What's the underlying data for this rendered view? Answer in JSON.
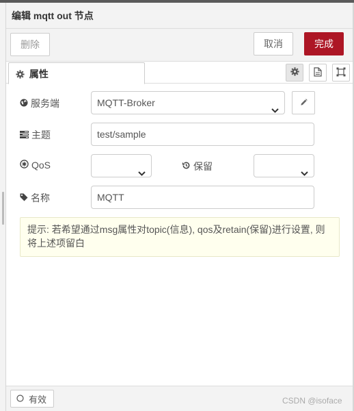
{
  "window": {
    "title": "编辑 mqtt out 节点"
  },
  "toolbar": {
    "delete_label": "删除",
    "cancel_label": "取消",
    "done_label": "完成"
  },
  "tabs": [
    {
      "label": "属性",
      "icon": "gear-icon",
      "active": true
    }
  ],
  "tab_icons": [
    "gear-icon",
    "document-icon",
    "frame-icon"
  ],
  "form": {
    "server": {
      "label": "服务端",
      "icon": "globe-icon",
      "value": "MQTT-Broker"
    },
    "topic": {
      "label": "主题",
      "icon": "tasks-icon",
      "value": "test/sample"
    },
    "qos": {
      "label": "QoS",
      "icon": "asterisk-circle-icon",
      "value": ""
    },
    "retain": {
      "label": "保留",
      "icon": "history-icon",
      "value": ""
    },
    "name": {
      "label": "名称",
      "icon": "tag-icon",
      "value": "MQTT"
    }
  },
  "tip": {
    "text": "提示: 若希望通过msg属性对topic(信息), qos及retain(保留)进行设置, 则将上述项留白"
  },
  "footer": {
    "enabled_label": "有效",
    "watermark": "CSDN @isoface"
  },
  "colors": {
    "accent": "#ad1625",
    "tip_background": "#ffffee",
    "panel_background": "#f3f3f3"
  }
}
